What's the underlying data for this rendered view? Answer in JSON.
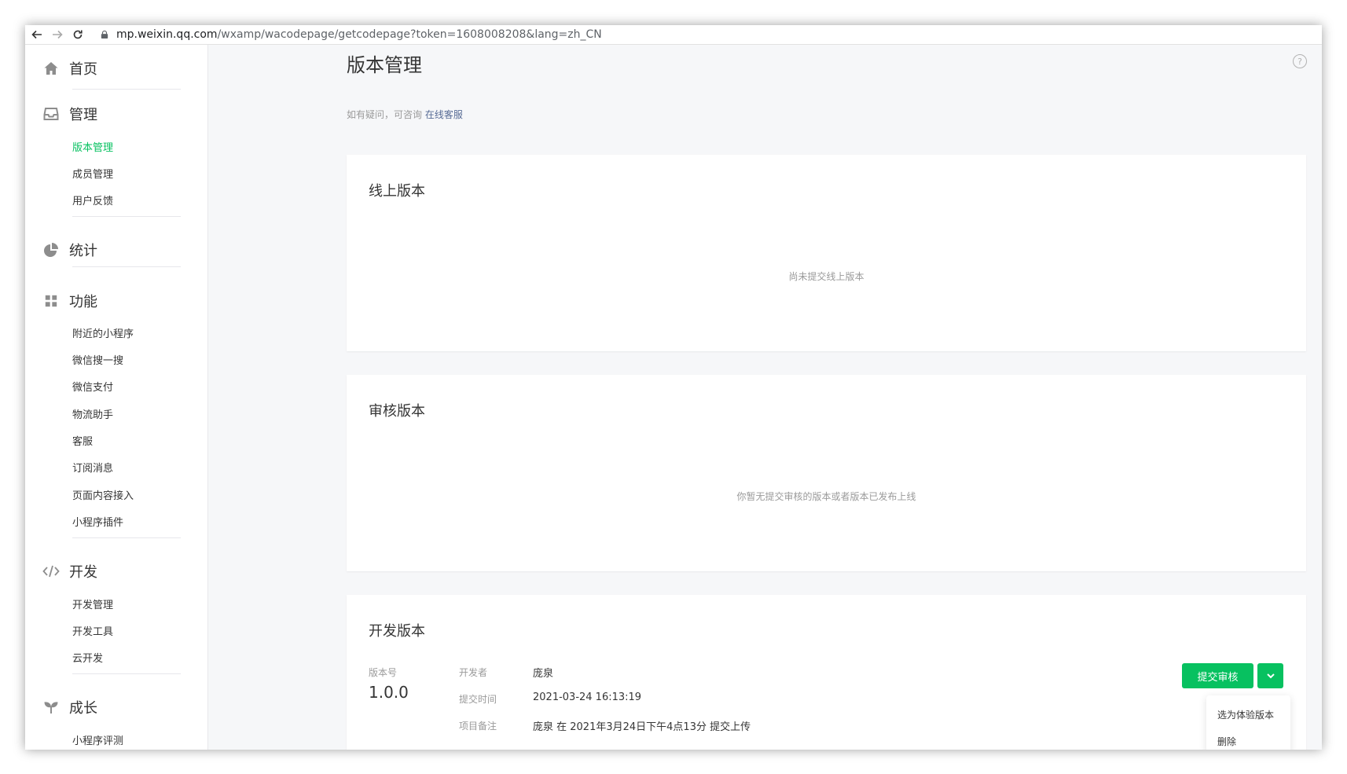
{
  "browser": {
    "url_host": "mp.weixin.qq.com",
    "url_path": "/wxamp/wacodepage/getcodepage?token=1608008208&lang=zh_CN"
  },
  "sidebar": {
    "sections": [
      {
        "label": "首页",
        "icon": "home-icon",
        "items": []
      },
      {
        "label": "管理",
        "icon": "inbox-icon",
        "items": [
          "版本管理",
          "成员管理",
          "用户反馈"
        ]
      },
      {
        "label": "统计",
        "icon": "pie-chart-icon",
        "items": []
      },
      {
        "label": "功能",
        "icon": "grid-icon",
        "items": [
          "附近的小程序",
          "微信搜一搜",
          "微信支付",
          "物流助手",
          "客服",
          "订阅消息",
          "页面内容接入",
          "小程序插件"
        ]
      },
      {
        "label": "开发",
        "icon": "code-icon",
        "items": [
          "开发管理",
          "开发工具",
          "云开发"
        ]
      },
      {
        "label": "成长",
        "icon": "sprout-icon",
        "items": [
          "小程序评测"
        ]
      }
    ],
    "active_item": "版本管理"
  },
  "main": {
    "title": "版本管理",
    "hint_text": "如有疑问，可咨询",
    "hint_link": "在线客服",
    "online": {
      "title": "线上版本",
      "empty": "尚未提交线上版本"
    },
    "review": {
      "title": "审核版本",
      "empty": "你暂无提交审核的版本或者版本已发布上线"
    },
    "dev": {
      "title": "开发版本",
      "version_label": "版本号",
      "version": "1.0.0",
      "developer_label": "开发者",
      "developer": "庞泉",
      "time_label": "提交时间",
      "time": "2021-03-24 16:13:19",
      "note_label": "项目备注",
      "note": "庞泉 在 2021年3月24日下午4点13分 提交上传",
      "submit_button": "提交审核",
      "menu": [
        "选为体验版本",
        "删除"
      ]
    }
  },
  "colors": {
    "accent": "#07c160",
    "link": "#576b95"
  }
}
